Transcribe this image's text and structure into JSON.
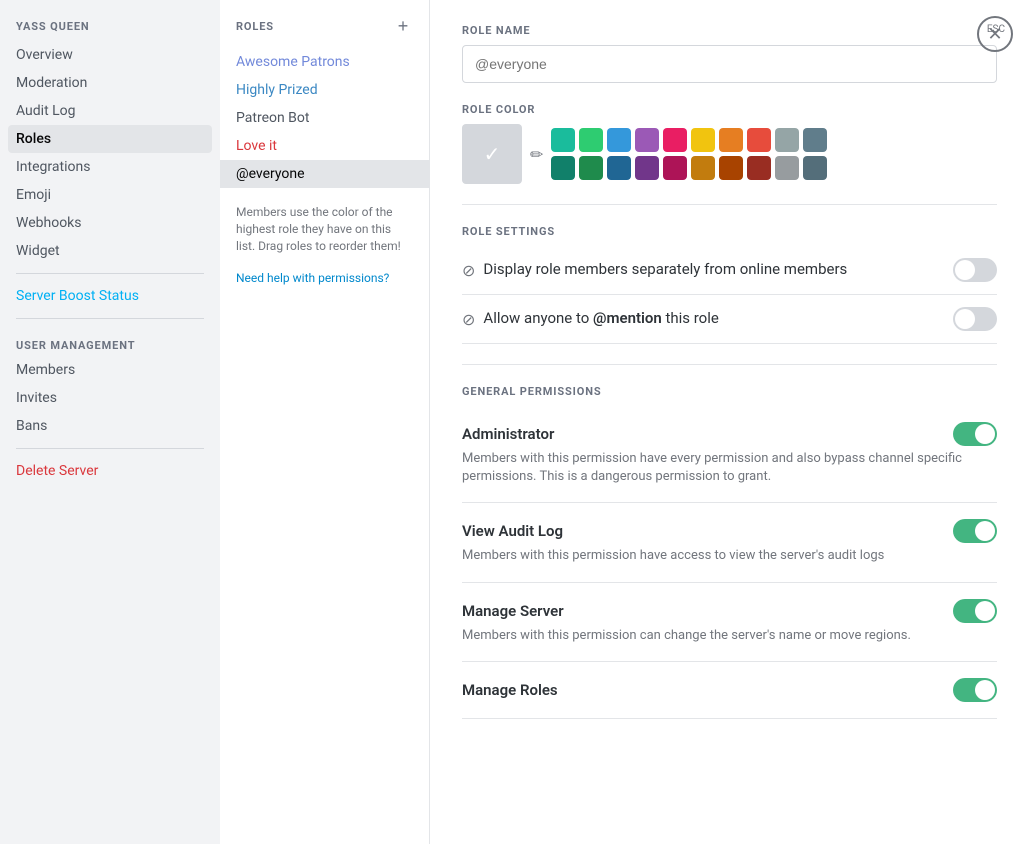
{
  "sidebar": {
    "server_name": "YASS QUEEN",
    "items": [
      {
        "label": "Overview",
        "id": "overview",
        "active": false
      },
      {
        "label": "Moderation",
        "id": "moderation",
        "active": false
      },
      {
        "label": "Audit Log",
        "id": "audit-log",
        "active": false
      },
      {
        "label": "Roles",
        "id": "roles",
        "active": true
      },
      {
        "label": "Integrations",
        "id": "integrations",
        "active": false
      },
      {
        "label": "Emoji",
        "id": "emoji",
        "active": false
      },
      {
        "label": "Webhooks",
        "id": "webhooks",
        "active": false
      },
      {
        "label": "Widget",
        "id": "widget",
        "active": false
      }
    ],
    "boost_label": "Server Boost Status",
    "user_management_label": "USER MANAGEMENT",
    "user_management_items": [
      {
        "label": "Members",
        "id": "members"
      },
      {
        "label": "Invites",
        "id": "invites"
      },
      {
        "label": "Bans",
        "id": "bans"
      }
    ],
    "delete_label": "Delete Server"
  },
  "roles_panel": {
    "header": "ROLES",
    "items": [
      {
        "label": "Awesome Patrons",
        "color": "purple",
        "id": "awesome-patrons"
      },
      {
        "label": "Highly Prized",
        "color": "blue",
        "id": "highly-prized"
      },
      {
        "label": "Patreon Bot",
        "color": "default",
        "id": "patreon-bot"
      },
      {
        "label": "Love it",
        "color": "red",
        "id": "love-it"
      },
      {
        "label": "@everyone",
        "color": "default",
        "id": "everyone",
        "selected": true
      }
    ],
    "info_text": "Members use the color of the highest role they have on this list. Drag roles to reorder them!",
    "help_link": "Need help with permissions?"
  },
  "main": {
    "role_name_label": "ROLE NAME",
    "role_name_placeholder": "@everyone",
    "role_color_label": "ROLE COLOR",
    "role_settings_label": "ROLE SETTINGS",
    "settings": [
      {
        "id": "display-separate",
        "text": "Display role members separately from online members",
        "on": false
      },
      {
        "id": "allow-mention",
        "text_prefix": "Allow anyone to ",
        "text_mention": "@mention",
        "text_suffix": " this role",
        "on": false
      }
    ],
    "general_permissions_label": "GENERAL PERMISSIONS",
    "permissions": [
      {
        "id": "administrator",
        "title": "Administrator",
        "desc": "Members with this permission have every permission and also bypass channel specific permissions. This is a dangerous permission to grant.",
        "on": true
      },
      {
        "id": "view-audit-log",
        "title": "View Audit Log",
        "desc": "Members with this permission have access to view the server's audit logs",
        "on": true
      },
      {
        "id": "manage-server",
        "title": "Manage Server",
        "desc": "Members with this permission can change the server's name or move regions.",
        "on": true
      },
      {
        "id": "manage-roles",
        "title": "Manage Roles",
        "desc": "",
        "on": true
      }
    ],
    "close_label": "ESC"
  },
  "colors": {
    "swatches": [
      "#1abc9c",
      "#2ecc71",
      "#3498db",
      "#9b59b6",
      "#e91e63",
      "#f1c40f",
      "#e67e22",
      "#e74c3c",
      "#95a5a6",
      "#607d8b",
      "#11806a",
      "#1f8b4c",
      "#206694",
      "#71368a",
      "#ad1457",
      "#c27c0e",
      "#a84300",
      "#992d22",
      "#979c9f",
      "#546e7a"
    ]
  }
}
